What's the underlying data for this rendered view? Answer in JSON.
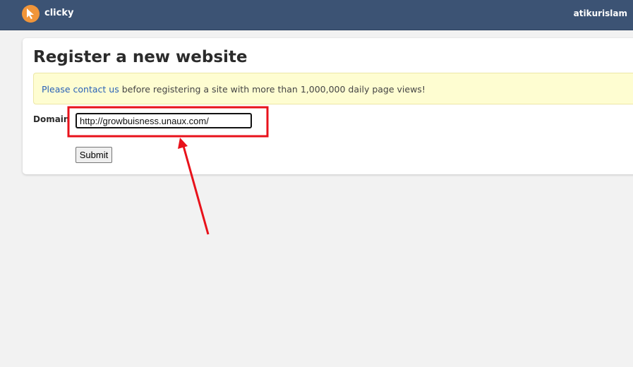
{
  "app": {
    "brand": "clicky",
    "username": "atikurislam",
    "logo_icon": "cursor-arrow-icon",
    "header_color": "#3c5374",
    "logo_color": "#f0953a"
  },
  "page": {
    "title": "Register a new website"
  },
  "notice": {
    "link_text": "Please contact us",
    "text": " before registering a site with more than 1,000,000 daily page views!",
    "background": "#fefdd1"
  },
  "form": {
    "domain_label": "Domain",
    "domain_value": "http://growbuisness.unaux.com/",
    "submit_label": "Submit"
  },
  "annotation": {
    "color": "#e8121b"
  }
}
